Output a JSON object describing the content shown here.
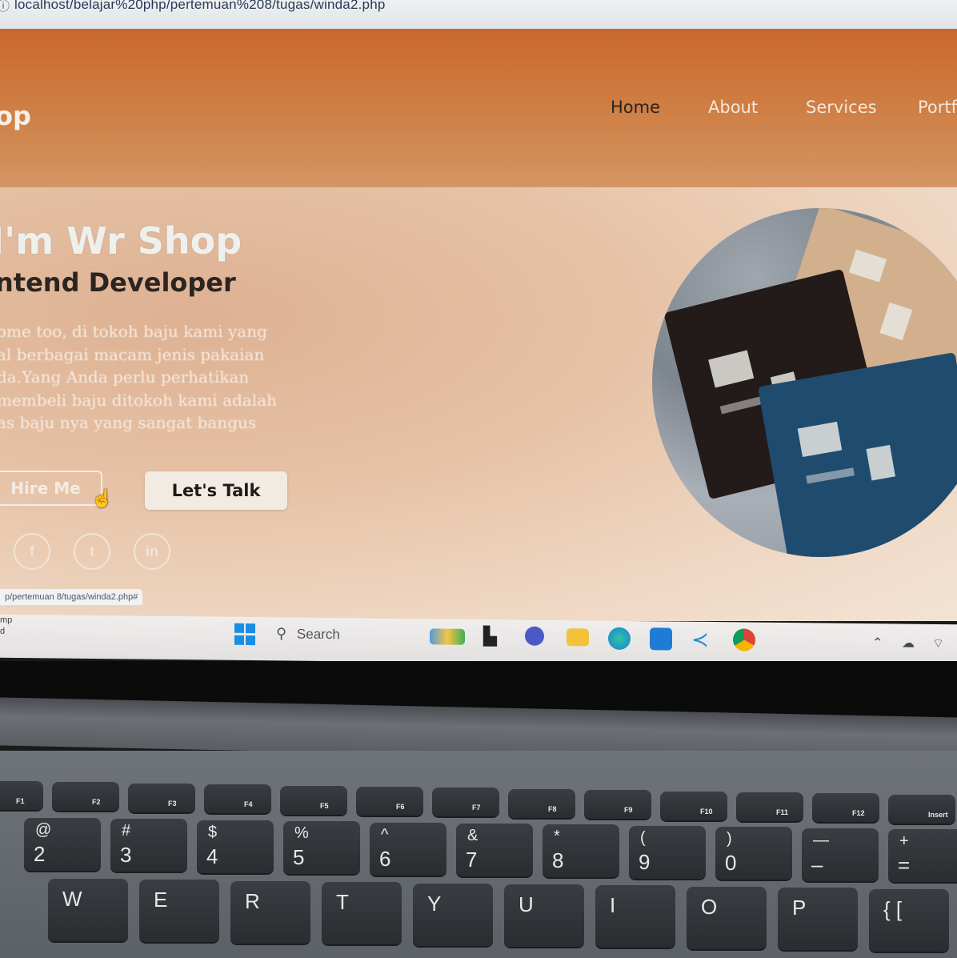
{
  "browser": {
    "url": "localhost/belajar%20php/pertemuan%208/tugas/winda2.php",
    "status_url": "p/pertemuan 8/tugas/winda2.php#"
  },
  "site": {
    "logo": "op",
    "nav": [
      "Home",
      "About",
      "Services",
      "Portf"
    ],
    "hero": {
      "title": "I'm Wr Shop",
      "subtitle": "ntend Developer",
      "description_lines": [
        "ome too, di tokoh baju kami yang",
        "al berbagai macam jenis pakaian",
        "da.Yang Anda perlu perhatikan",
        "membeli baju ditokoh kami adalah",
        "as baju nya yang sangat bangus"
      ],
      "hire_button": "Hire Me",
      "talk_button": "Let's Talk",
      "social": [
        "f",
        "t",
        "in"
      ]
    }
  },
  "taskbar": {
    "left_text": [
      "mp",
      "d"
    ],
    "search_placeholder": "Search",
    "apps": [
      "widgets-icon",
      "task-view-icon",
      "chat-icon",
      "file-explorer-icon",
      "edge-icon",
      "store-icon",
      "vscode-icon",
      "chrome-icon"
    ]
  },
  "keyboard": {
    "fn_row": [
      "F1",
      "F2",
      "F3",
      "F4",
      "F5",
      "F6",
      "F7",
      "F8",
      "F9",
      "F10",
      "F11",
      "F12",
      "Insert"
    ],
    "number_row": [
      {
        "top": "@",
        "main": "2"
      },
      {
        "top": "#",
        "main": "3"
      },
      {
        "top": "$",
        "main": "4"
      },
      {
        "top": "%",
        "main": "5"
      },
      {
        "top": "^",
        "main": "6"
      },
      {
        "top": "&",
        "main": "7"
      },
      {
        "top": "*",
        "main": "8"
      },
      {
        "top": "(",
        "main": "9"
      },
      {
        "top": ")",
        "main": "0"
      },
      {
        "top": "—",
        "main": "–"
      },
      {
        "top": "+",
        "main": "="
      }
    ],
    "letter_row": [
      "W",
      "E",
      "R",
      "T",
      "Y",
      "U",
      "I",
      "O",
      "P",
      "{ ["
    ]
  }
}
